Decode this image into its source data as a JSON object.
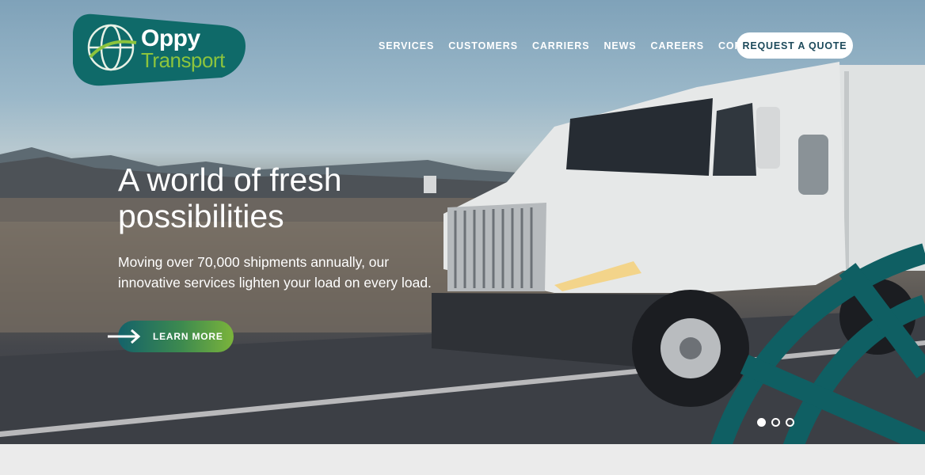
{
  "brand": {
    "name_line1": "Oppy",
    "name_line2": "Transport",
    "colors": {
      "teal": "#0f5f63",
      "lime": "#8cc43d",
      "navy": "#1d4a5b"
    }
  },
  "nav": {
    "items": [
      "SERVICES",
      "CUSTOMERS",
      "CARRIERS",
      "NEWS",
      "CAREERS",
      "CONTACT"
    ],
    "cta_label": "REQUEST A QUOTE"
  },
  "hero": {
    "headline_line1": "A world of fresh",
    "headline_line2": "possibilities",
    "sub_line1": "Moving over 70,000 shipments annually, our",
    "sub_line2": "innovative services lighten your load on every load.",
    "button_label": "LEARN MORE",
    "button_icon": "arrow-right-icon"
  },
  "carousel": {
    "slide_count": 3,
    "active_index": 0
  }
}
